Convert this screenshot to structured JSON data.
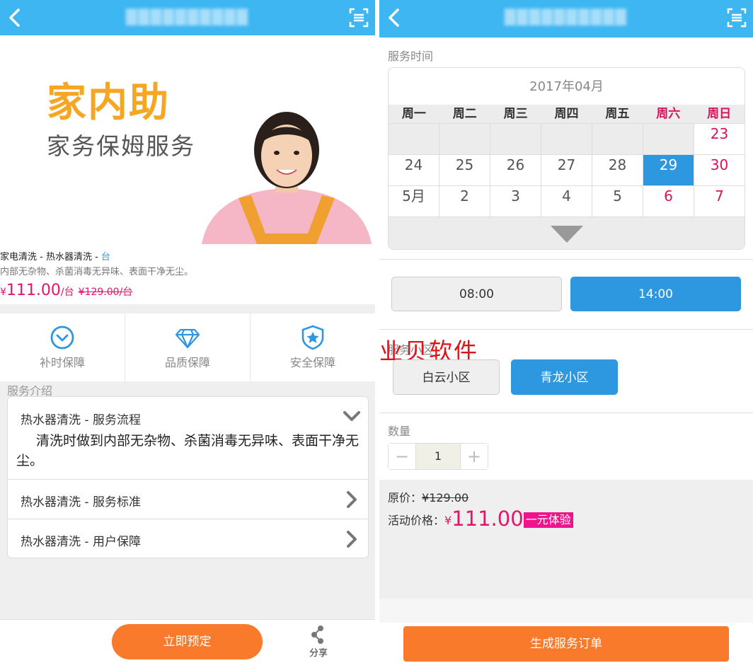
{
  "left": {
    "topbar": {
      "title": "██████████"
    },
    "banner": {
      "title": "家内助",
      "subtitle": "家务保姆服务"
    },
    "product": {
      "name": "家电清洗 - 热水器清洗 - ",
      "unit": "台",
      "description": "内部无杂物、杀菌消毒无异味、表面干净无尘。",
      "currency": "¥",
      "price": "111.00",
      "per_unit": "/台",
      "original_price": "¥129.00/台"
    },
    "guarantees": [
      {
        "label": "补时保障",
        "icon": "clock-check-icon"
      },
      {
        "label": "品质保障",
        "icon": "diamond-icon"
      },
      {
        "label": "安全保障",
        "icon": "shield-star-icon"
      }
    ],
    "intro": {
      "section_title": "服务介绍",
      "items": [
        {
          "title": "热水器清洗 - 服务流程",
          "body": "清洗时做到内部无杂物、杀菌消毒无异味、表面干净无尘。"
        },
        {
          "title": "热水器清洗 - 服务标准"
        },
        {
          "title": "热水器清洗 - 用户保障"
        }
      ]
    },
    "bottom": {
      "reserve_label": "立即预定",
      "share_label": "分享"
    }
  },
  "right": {
    "topbar": {
      "title": "██████████"
    },
    "service_time_label": "服务时间",
    "calendar": {
      "month": "2017年04月",
      "weekdays": [
        "周一",
        "周二",
        "周三",
        "周四",
        "周五",
        "周六",
        "周日"
      ],
      "rows": [
        [
          "",
          "",
          "",
          "",
          "",
          "",
          "23"
        ],
        [
          "24",
          "25",
          "26",
          "27",
          "28",
          "29",
          "30"
        ],
        [
          "5月",
          "2",
          "3",
          "4",
          "5",
          "6",
          "7"
        ]
      ],
      "selected": "29"
    },
    "times": [
      {
        "label": "08:00",
        "selected": false
      },
      {
        "label": "14:00",
        "selected": true
      }
    ],
    "area_label": "服务小区",
    "areas": [
      {
        "label": "白云小区",
        "selected": false
      },
      {
        "label": "青龙小区",
        "selected": true
      }
    ],
    "watermark": "业贝软件",
    "quantity": {
      "label": "数量",
      "minus": "−",
      "value": "1",
      "plus": "+"
    },
    "pricing": {
      "original_label": "原价：",
      "original_value": "¥129.00",
      "activity_label": "活动价格：",
      "currency": "¥",
      "activity_price": "111.00",
      "badge": "一元体验"
    },
    "order_label": "生成服务订单"
  },
  "colors": {
    "topbar": "#3eb6f2",
    "accent_blue": "#2d97e0",
    "price_pink": "#e4156b",
    "weekend_red": "#d4155c",
    "button_orange": "#f97a2a",
    "watermark_red": "#e0121a"
  }
}
